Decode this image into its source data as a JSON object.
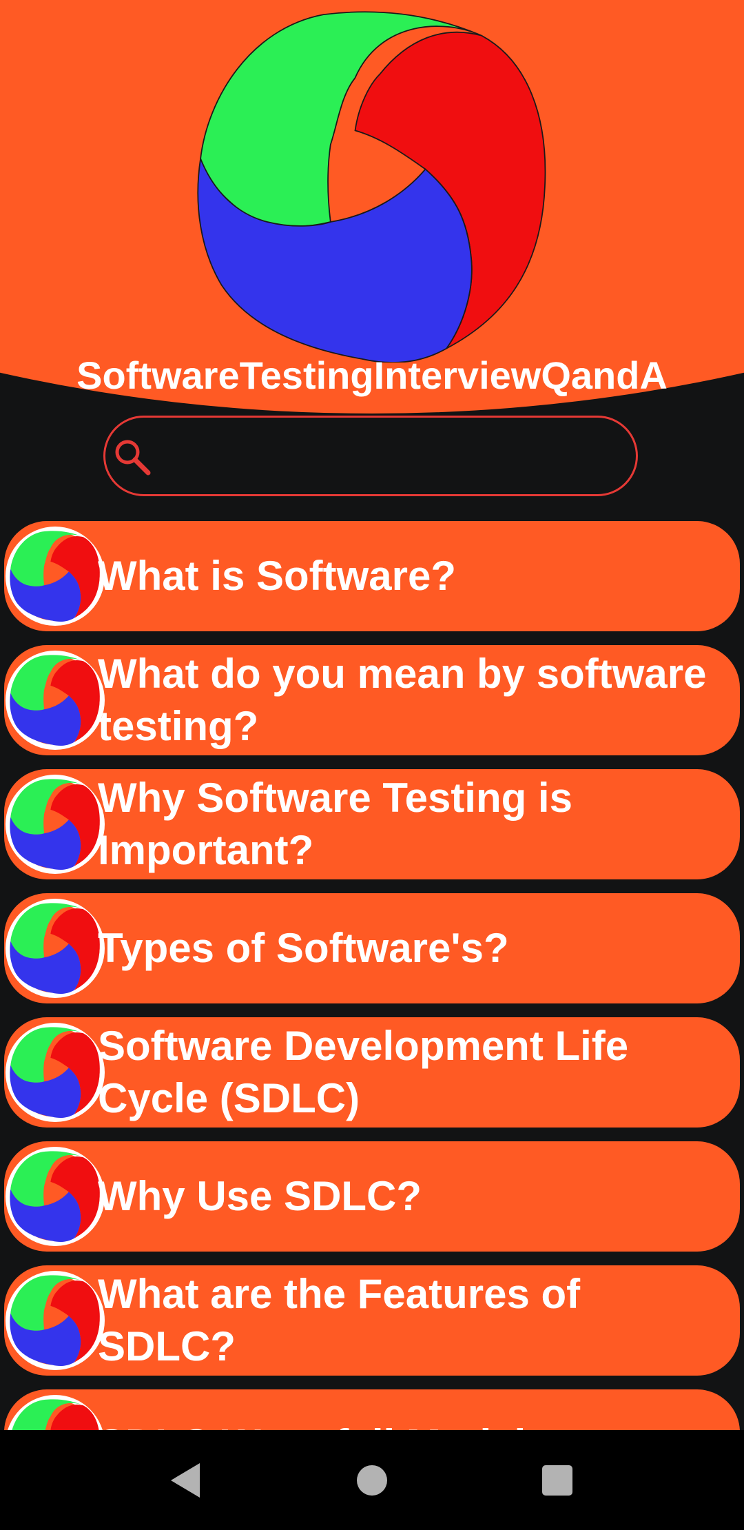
{
  "app": {
    "title": "SoftwareTestingInterviewQandA"
  },
  "search": {
    "value": "",
    "placeholder": "",
    "icon": "search-icon"
  },
  "colors": {
    "accent": "#FF5A24",
    "background": "#121314",
    "search_border": "#E53935",
    "logo_green": "#2BEF55",
    "logo_red": "#F00E10",
    "logo_blue": "#3434EC"
  },
  "topics": [
    {
      "label": "What is Software?"
    },
    {
      "label": "What do you mean by software testing?"
    },
    {
      "label": "Why Software Testing is Important?"
    },
    {
      "label": "Types of Software's?"
    },
    {
      "label": "Software Development Life Cycle (SDLC)"
    },
    {
      "label": "Why Use SDLC?"
    },
    {
      "label": "What are the Features of SDLC?"
    },
    {
      "label": "SDLC Waterfall Model"
    }
  ],
  "navbar": {
    "icons": [
      "back-icon",
      "home-icon",
      "recents-icon"
    ]
  }
}
